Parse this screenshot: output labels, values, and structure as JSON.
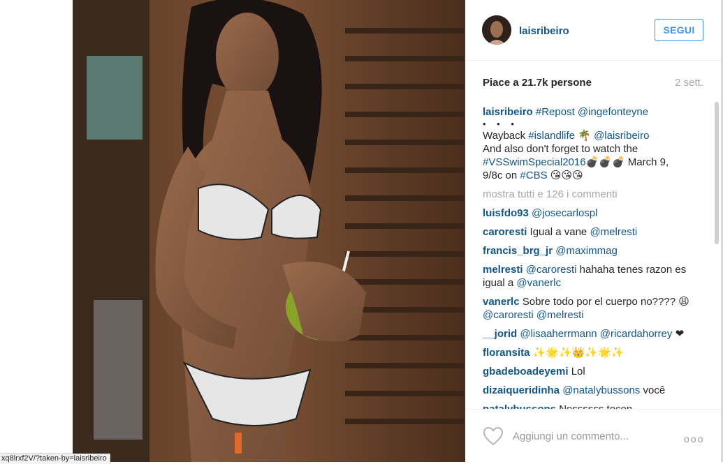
{
  "post": {
    "username": "laisribeiro",
    "follow_label": "SEGUI",
    "likes_text": "Piace a 21.7k persone",
    "time_ago": "2 sett."
  },
  "caption": {
    "username": "laisribeiro",
    "line1_tag": "#Repost",
    "line1_mention": "@ingefonteyne",
    "dots": "• • •",
    "line2_text": "Wayback",
    "line2_tag": "#islandlife",
    "line2_emoji": "🌴",
    "line2_mention": "@laisribeiro",
    "line3_text": "And also don't forget to watch the",
    "line4_tag": "#VSSwimSpecial2016",
    "line4_emoji": "💣💣💣",
    "line4_text": " March 9,",
    "line5_text": "9/8c on",
    "line5_tag": "#CBS",
    "line5_emoji": "😘😘😘"
  },
  "show_all_comments": "mostra tutti e 126 i commenti",
  "comments": [
    {
      "user": "luisfdo93",
      "text": "@josecarlospl"
    },
    {
      "user": "caroresti",
      "text": "Igual a vane",
      "mention": "@melresti"
    },
    {
      "user": "francis_brg_jr",
      "text": "@maximmag"
    },
    {
      "user": "melresti",
      "mention": "@caroresti",
      "text": " hahaha tenes razon es igual a ",
      "mention2": "@vanerlc"
    },
    {
      "user": "vanerlc",
      "text": "Sobre todo por el cuerpo no????",
      "emoji": "😩",
      "mention": "@caroresti",
      "mention2": "@melresti"
    },
    {
      "user": "__jorid",
      "text": "@lisaaherrmann @ricardahorrey",
      "emoji": "❤"
    },
    {
      "user": "floransita",
      "emoji": "✨🌟✨👑✨🌟✨"
    },
    {
      "user": "gbadeboadeyemi",
      "text": "Lol"
    },
    {
      "user": "dizaiqueridinha",
      "text": "@natalybussons",
      "tail": " você"
    },
    {
      "user": "natalybussons",
      "text": "Nossssss tocon"
    }
  ],
  "footer": {
    "add_comment_placeholder": "Aggiungi un commento...",
    "more_options": "ooo"
  },
  "status_bar_url": "xq8lrxf2V/?taken-by=laisribeiro",
  "colors": {
    "link": "#125688",
    "follow_button": "#3897f0",
    "muted": "#a5a7aa"
  },
  "icons": {
    "like": "heart-outline-icon",
    "options": "more-options-icon"
  }
}
